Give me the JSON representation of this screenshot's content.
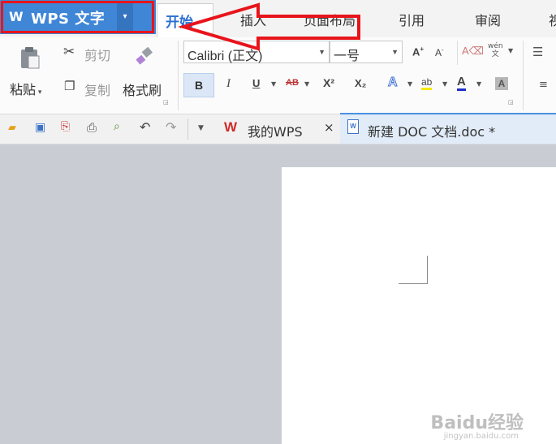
{
  "app_button": {
    "logo": "W",
    "title": "WPS 文字",
    "dropdown": "▾"
  },
  "tabs": [
    "开始",
    "插入",
    "页面布局",
    "引用",
    "审阅",
    "视"
  ],
  "clipboard": {
    "paste": "粘贴",
    "cut": "剪切",
    "copy": "复制",
    "format_painter": "格式刷"
  },
  "font": {
    "family": "Calibri (正文)",
    "size": "一号"
  },
  "format_buttons": {
    "bold": "B",
    "italic": "I",
    "underline": "U",
    "strike": "AB",
    "superscript": "X²",
    "subscript": "X₂"
  },
  "doc_tabs": [
    {
      "label": "我的WPS",
      "close": "×"
    },
    {
      "label": "新建 DOC 文档.doc *"
    }
  ],
  "watermark": {
    "logo": "Baidu经验",
    "url": "jingyan.baidu.com"
  },
  "colors": {
    "app_blue": "#3f86d6",
    "highlight_red": "#e8141b",
    "tab_active": "#2b6fd0"
  }
}
